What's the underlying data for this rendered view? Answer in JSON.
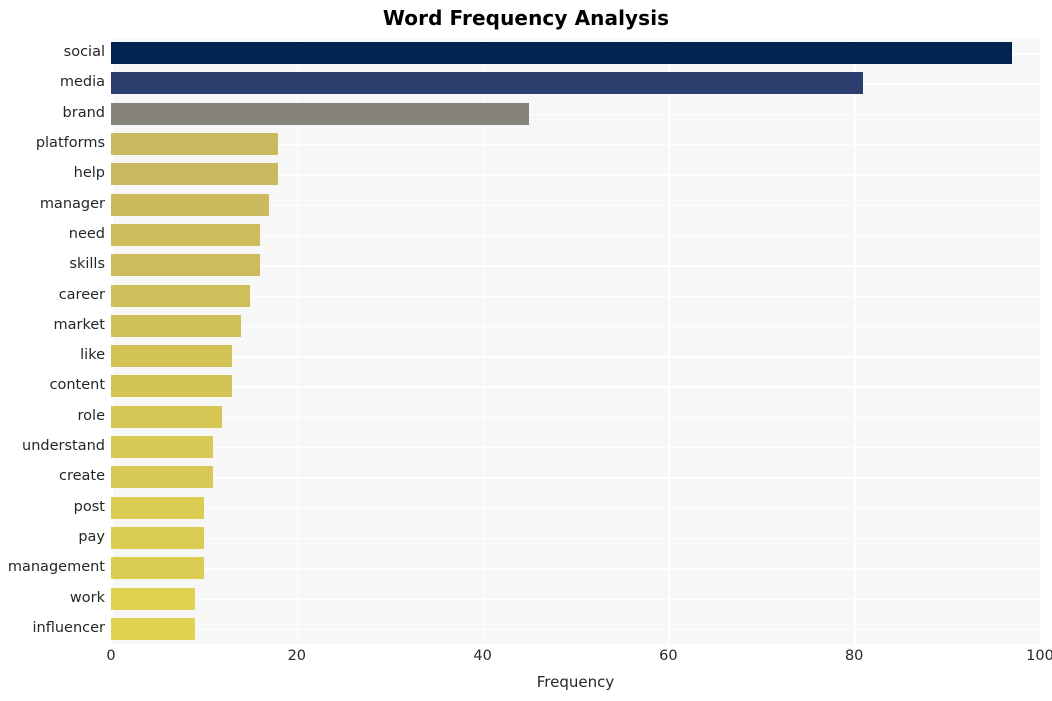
{
  "chart_data": {
    "type": "bar",
    "orientation": "horizontal",
    "title": "Word Frequency Analysis",
    "xlabel": "Frequency",
    "ylabel": "",
    "xlim": [
      0,
      100
    ],
    "xticks": [
      0,
      20,
      40,
      60,
      80,
      100
    ],
    "xtick_labels": [
      "0",
      "20",
      "40",
      "60",
      "80",
      "100"
    ],
    "grid": true,
    "grid_color": "#ffffff",
    "plot_background": "#f7f7f7",
    "legend": null,
    "categories": [
      "social",
      "media",
      "brand",
      "platforms",
      "help",
      "manager",
      "need",
      "skills",
      "career",
      "market",
      "like",
      "content",
      "role",
      "understand",
      "create",
      "post",
      "pay",
      "management",
      "work",
      "influencer"
    ],
    "values": [
      97,
      81,
      45,
      18,
      18,
      17,
      16,
      16,
      15,
      14,
      13,
      13,
      12,
      11,
      11,
      10,
      10,
      10,
      9,
      9
    ],
    "bar_colors": [
      "#00244f",
      "#2c3e6e",
      "#85837b",
      "#c9b85d",
      "#c9b85d",
      "#cbba5e",
      "#cdbc5c",
      "#cdbc5c",
      "#cfbf5b",
      "#d1c159",
      "#d4c457",
      "#d4c457",
      "#d6c656",
      "#d8c954",
      "#d8c954",
      "#dbcc52",
      "#dbcc52",
      "#dbcc52",
      "#e0d150",
      "#e0d150"
    ]
  },
  "axis": {
    "x_label": "Frequency"
  }
}
